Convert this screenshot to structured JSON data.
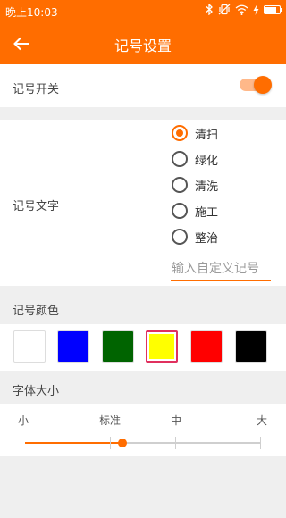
{
  "status_bar": {
    "time": "晚上10:03",
    "icons": [
      "bluetooth-icon",
      "mute-vibrate-icon",
      "wifi-icon",
      "charging-icon",
      "battery-icon"
    ],
    "battery_level": 0.8
  },
  "toolbar": {
    "title": "记号设置",
    "back_icon": "arrow-back-icon"
  },
  "mark_switch": {
    "label": "记号开关",
    "on": true
  },
  "mark_text": {
    "label": "记号文字",
    "options": [
      {
        "label": "清扫",
        "selected": true
      },
      {
        "label": "绿化",
        "selected": false
      },
      {
        "label": "清洗",
        "selected": false
      },
      {
        "label": "施工",
        "selected": false
      },
      {
        "label": "整治",
        "selected": false
      }
    ],
    "custom_placeholder": "输入自定义记号",
    "custom_value": ""
  },
  "mark_color": {
    "label": "记号颜色",
    "options": [
      "#ffffff",
      "#0000ff",
      "#006400",
      "#ffff00",
      "#ff0000",
      "#000000"
    ],
    "selected_index": 3
  },
  "font_size": {
    "label": "字体大小",
    "levels": [
      "小",
      "标准",
      "中",
      "大"
    ],
    "selected_index": 1
  },
  "colors": {
    "accent": "#ff6d00",
    "selection_border": "#e0305e"
  }
}
